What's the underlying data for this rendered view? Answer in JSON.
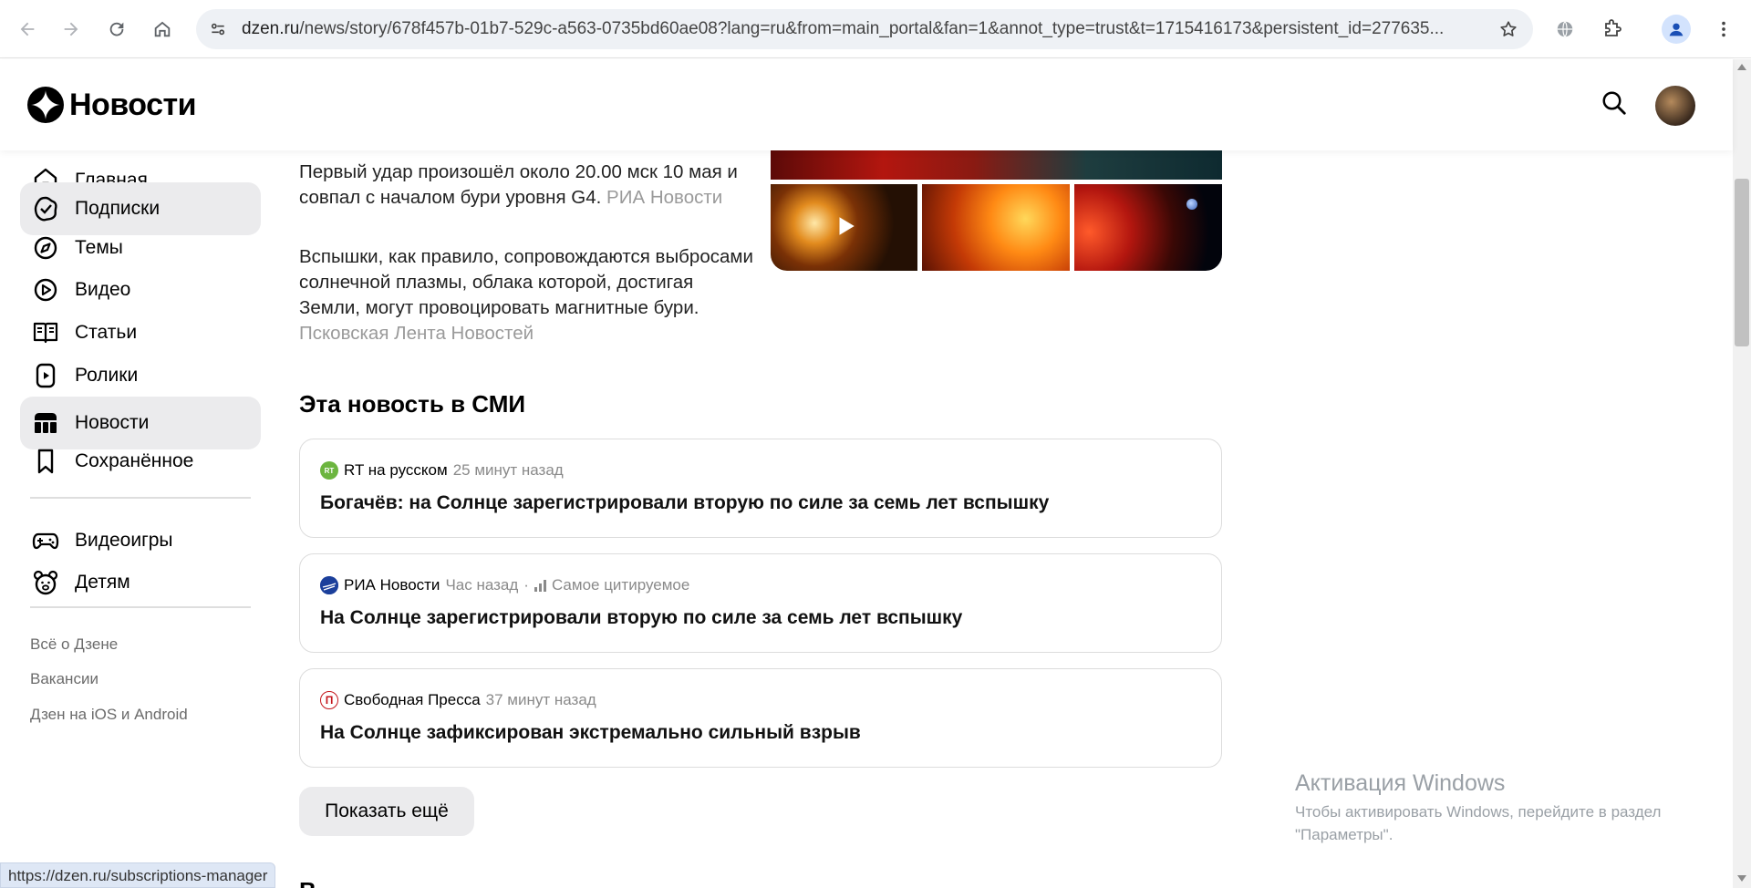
{
  "browser": {
    "url_host": "dzen.ru",
    "url_rest": "/news/story/678f457b-01b7-529c-a563-0735bd60ae08?lang=ru&from=main_portal&fan=1&annot_type=trust&t=1715416173&persistent_id=277635...",
    "status_url": "https://dzen.ru/subscriptions-manager"
  },
  "header": {
    "logo_text": "Новости"
  },
  "sidebar": {
    "items": [
      {
        "label": "Главная",
        "icon": "home-icon"
      },
      {
        "label": "Подписки",
        "icon": "subscriptions-icon"
      },
      {
        "label": "Темы",
        "icon": "compass-icon"
      },
      {
        "label": "Видео",
        "icon": "video-icon"
      },
      {
        "label": "Статьи",
        "icon": "articles-icon"
      },
      {
        "label": "Ролики",
        "icon": "clips-icon"
      },
      {
        "label": "Новости",
        "icon": "news-icon"
      },
      {
        "label": "Сохранённое",
        "icon": "bookmark-icon"
      },
      {
        "label": "Видеоигры",
        "icon": "gamepad-icon"
      },
      {
        "label": "Детям",
        "icon": "kids-icon"
      }
    ],
    "footer_links": [
      "Всё о Дзене",
      "Вакансии",
      "Дзен на iOS и Android"
    ]
  },
  "article": {
    "para1_text": "Первый удар произошёл около 20.00 мск 10 мая и совпал с началом бури уровня G4.",
    "para1_source": "РИА Новости",
    "para2_text": "Вспышки, как правило, сопровождаются выбросами солнечной плазмы, облака которой, достигая Земли, могут провоцировать магнитные бури.",
    "para2_source": "Псковская Лента Новостей"
  },
  "media_section": {
    "title": "Эта новость в СМИ",
    "cards": [
      {
        "source": "RT на русском",
        "icon_text": "RT",
        "time": "25 минут назад",
        "extra": "",
        "title": "Богачёв: на Солнце зарегистрировали вторую по силе за семь лет вспышку"
      },
      {
        "source": "РИА Новости",
        "icon_text": "",
        "time": "Час назад",
        "extra": "Самое цитируемое",
        "title": "На Солнце зарегистрировали вторую по силе за семь лет вспышку"
      },
      {
        "source": "Свободная Пресса",
        "icon_text": "П",
        "time": "37 минут назад",
        "extra": "",
        "title": "На Солнце зафиксирован экстремально сильный взрыв"
      }
    ],
    "more_button": "Показать ещё",
    "separator": "·"
  },
  "windows_watermark": {
    "title": "Активация Windows",
    "subtitle": "Чтобы активировать Windows, перейдите в раздел \"Параметры\"."
  },
  "colors": {
    "accent_active_bg": "#ebebed",
    "source_muted": "#9a9a9a",
    "rt_green": "#6cb53f",
    "ria_blue": "#1b3f9b",
    "svpressa_red": "#c4161c"
  }
}
